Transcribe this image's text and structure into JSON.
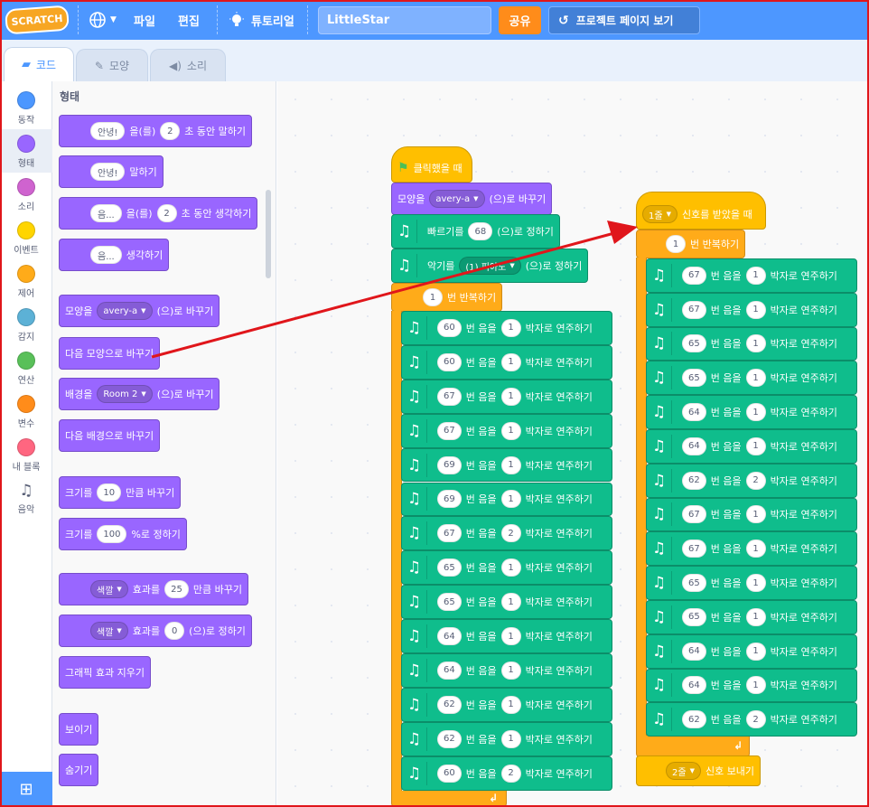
{
  "menubar": {
    "logo": "SCRATCH",
    "globe_icon": "globe-icon",
    "file": "파일",
    "edit": "편집",
    "tutorial": "튜토리얼",
    "project_title": "LittleStar",
    "share": "공유",
    "see_project": "프로젝트 페이지 보기"
  },
  "tabs": {
    "code": "코드",
    "costume": "모양",
    "sound": "소리"
  },
  "categories": [
    {
      "label": "동작",
      "color": "#4c97ff"
    },
    {
      "label": "형태",
      "color": "#9966ff"
    },
    {
      "label": "소리",
      "color": "#cf63cf"
    },
    {
      "label": "이벤트",
      "color": "#ffd500"
    },
    {
      "label": "제어",
      "color": "#ffab19"
    },
    {
      "label": "감지",
      "color": "#5cb1d6"
    },
    {
      "label": "연산",
      "color": "#59c059"
    },
    {
      "label": "변수",
      "color": "#ff8c1a"
    },
    {
      "label": "내 블록",
      "color": "#ff6680"
    },
    {
      "label": "음악",
      "color": ""
    }
  ],
  "palette": {
    "title": "형태",
    "say_for": {
      "text": "안녕!",
      "mid": "을(를)",
      "secs": "2",
      "tail": "초 동안 말하기"
    },
    "say": {
      "text": "안녕!",
      "tail": "말하기"
    },
    "think_for": {
      "text": "음...",
      "mid": "을(를)",
      "secs": "2",
      "tail": "초 동안 생각하기"
    },
    "think": {
      "text": "음...",
      "tail": "생각하기"
    },
    "switch_costume": {
      "head": "모양을",
      "value": "avery-a",
      "tail": "(으)로 바꾸기"
    },
    "next_costume": "다음 모양으로 바꾸기",
    "switch_backdrop": {
      "head": "배경을",
      "value": "Room 2",
      "tail": "(으)로 바꾸기"
    },
    "next_backdrop": "다음 배경으로 바꾸기",
    "change_size": {
      "head": "크기를",
      "value": "10",
      "tail": "만큼 바꾸기"
    },
    "set_size": {
      "head": "크기를",
      "value": "100",
      "tail": "%로 정하기"
    },
    "change_effect": {
      "menu": "색깔",
      "mid": "효과를",
      "value": "25",
      "tail": "만큼 바꾸기"
    },
    "set_effect": {
      "menu": "색깔",
      "mid": "효과를",
      "value": "0",
      "tail": "(으)로 정하기"
    },
    "clear_effects": "그래픽 효과 지우기",
    "show": "보이기",
    "hide": "숨기기"
  },
  "script1": {
    "hat": "클릭했을 때",
    "costume": {
      "head": "모양을",
      "value": "avery-a",
      "tail": "(으)로 바꾸기"
    },
    "tempo": {
      "head": "빠르기를",
      "value": "68",
      "tail": "(으)로 정하기"
    },
    "instrument": {
      "head": "악기를",
      "value": "(1) 피아노",
      "tail": "(으)로 정하기"
    },
    "repeat": {
      "value": "1",
      "tail": "번 반복하기"
    },
    "notes": [
      {
        "note": "60",
        "beats": "1"
      },
      {
        "note": "60",
        "beats": "1"
      },
      {
        "note": "67",
        "beats": "1"
      },
      {
        "note": "67",
        "beats": "1"
      },
      {
        "note": "69",
        "beats": "1"
      },
      {
        "note": "69",
        "beats": "1"
      },
      {
        "note": "67",
        "beats": "2"
      },
      {
        "note": "65",
        "beats": "1"
      },
      {
        "note": "65",
        "beats": "1"
      },
      {
        "note": "64",
        "beats": "1"
      },
      {
        "note": "64",
        "beats": "1"
      },
      {
        "note": "62",
        "beats": "1"
      },
      {
        "note": "62",
        "beats": "1"
      },
      {
        "note": "60",
        "beats": "2"
      }
    ]
  },
  "script2": {
    "hat": {
      "menu": "1줄",
      "tail": "신호를 받았을 때"
    },
    "repeat": {
      "value": "1",
      "tail": "번 반복하기"
    },
    "notes": [
      {
        "note": "67",
        "beats": "1"
      },
      {
        "note": "67",
        "beats": "1"
      },
      {
        "note": "65",
        "beats": "1"
      },
      {
        "note": "65",
        "beats": "1"
      },
      {
        "note": "64",
        "beats": "1"
      },
      {
        "note": "64",
        "beats": "1"
      },
      {
        "note": "62",
        "beats": "2"
      },
      {
        "note": "67",
        "beats": "1"
      },
      {
        "note": "67",
        "beats": "1"
      },
      {
        "note": "65",
        "beats": "1"
      },
      {
        "note": "65",
        "beats": "1"
      },
      {
        "note": "64",
        "beats": "1"
      },
      {
        "note": "64",
        "beats": "1"
      },
      {
        "note": "62",
        "beats": "2"
      }
    ],
    "broadcast": {
      "menu": "2줄",
      "tail": "신호 보내기"
    }
  },
  "note_block": {
    "mid": "번 음을",
    "tail": "박자로 연주하기"
  },
  "colors": {
    "looks": "#9966ff",
    "events": "#ffbf00",
    "control": "#ffab19",
    "music": "#0fbd8c",
    "menubar": "#4d97ff",
    "annotation_arrow": "#e0161b"
  }
}
